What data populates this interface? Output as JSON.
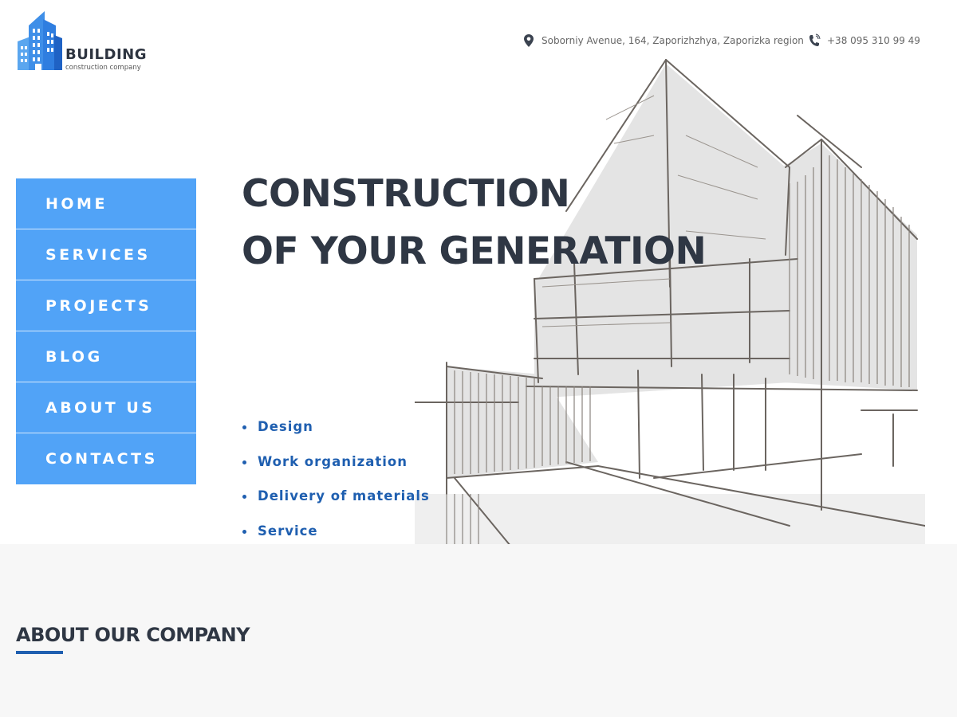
{
  "brand": {
    "name": "BUILDING",
    "tagline": "construction company",
    "colors": {
      "primary": "#51a3f7",
      "dark_blue": "#1f5fb0",
      "logo_blue": "#2f7ee0",
      "heading": "#2f3744"
    }
  },
  "header": {
    "address": "Soborniy Avenue, 164, Zaporizhzhya, Zaporizka region",
    "phone": "+38 095 310 99 49",
    "address_icon": "map-pin-icon",
    "phone_icon": "phone-icon"
  },
  "nav": {
    "items": [
      {
        "label": "HOME"
      },
      {
        "label": "SERVICES"
      },
      {
        "label": "PROJECTS"
      },
      {
        "label": "BLOG"
      },
      {
        "label": "ABOUT US"
      },
      {
        "label": "CONTACTS"
      }
    ]
  },
  "hero": {
    "headline_line1": "CONSTRUCTION",
    "headline_line2": "OF YOUR GENERATION",
    "features": [
      "Design",
      "Work organization",
      "Delivery of materials",
      "Service"
    ]
  },
  "about": {
    "title": "ABOUT OUR COMPANY"
  }
}
